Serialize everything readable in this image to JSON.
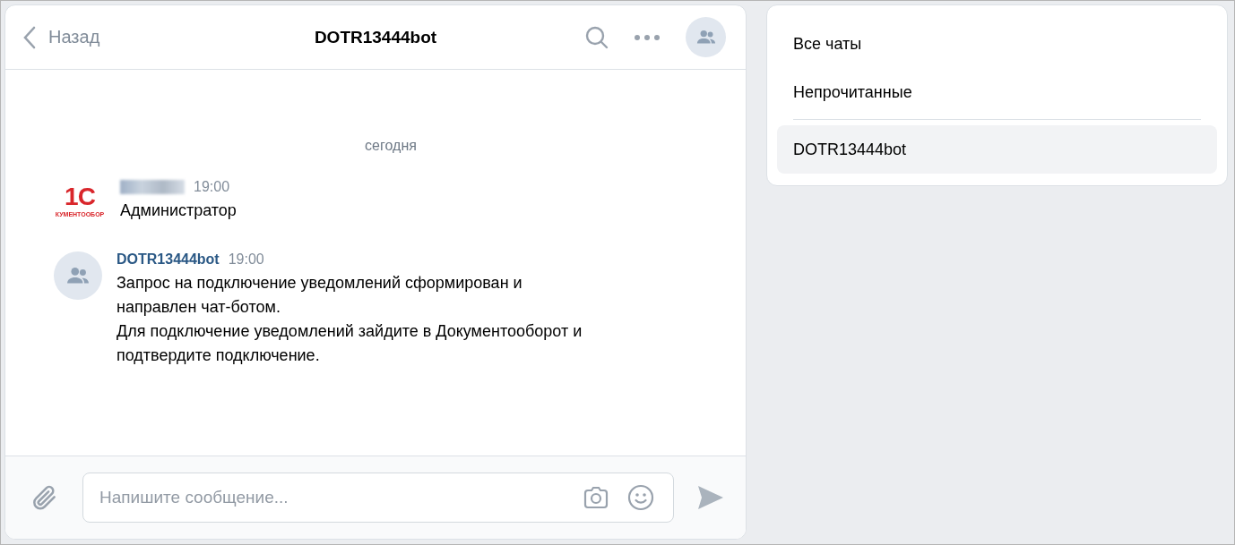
{
  "header": {
    "back": "Назад",
    "title": "DOTR13444bot"
  },
  "date_divider": "сегодня",
  "messages": [
    {
      "kind": "logo",
      "logo": {
        "mark": "1С",
        "caption": "КУМЕНТООБОР"
      },
      "author_hidden": true,
      "time": "19:00",
      "lines": [
        "Администратор"
      ]
    },
    {
      "kind": "bot",
      "author": "DOTR13444bot",
      "time": "19:00",
      "lines": [
        "Запрос на подключение уведомлений сформирован и",
        "направлен чат-ботом.",
        "Для подключение уведомлений зайдите в Документооборот и",
        "подтвердите подключение."
      ]
    }
  ],
  "composer": {
    "placeholder": "Напишите сообщение..."
  },
  "chat_list": [
    {
      "label": "Все чаты",
      "selected": false
    },
    {
      "label": "Непрочитанные",
      "selected": false
    },
    {
      "label": "DOTR13444bot",
      "selected": true
    }
  ]
}
